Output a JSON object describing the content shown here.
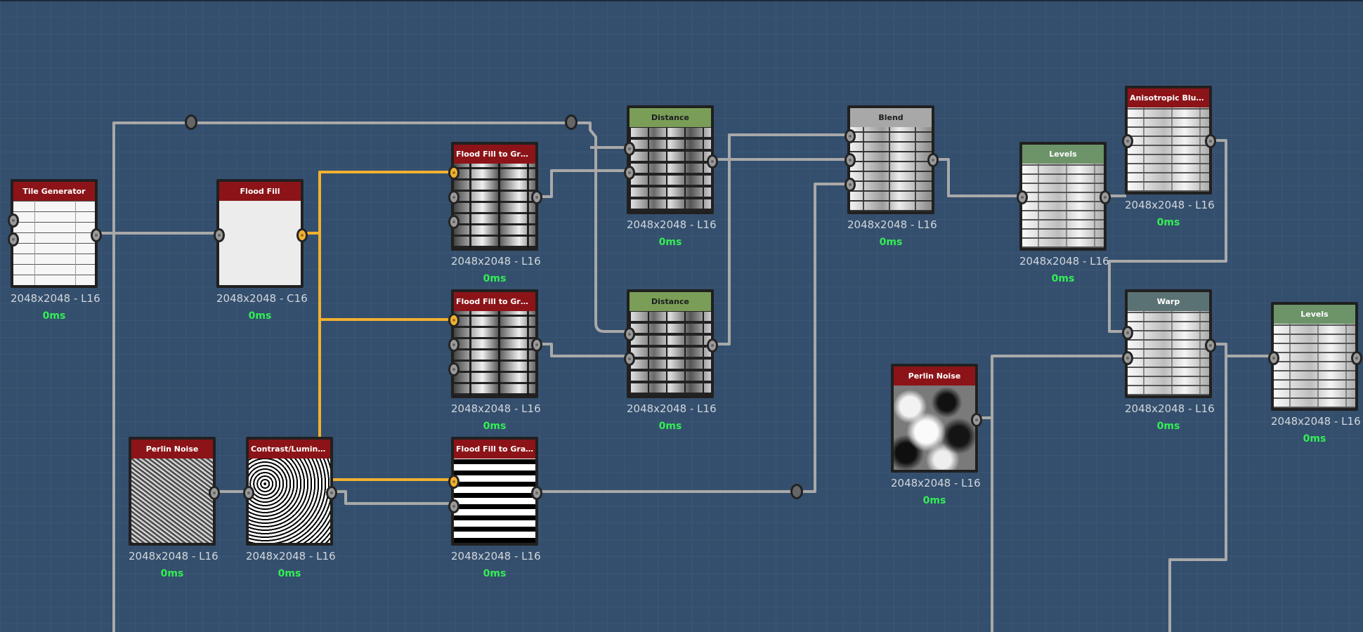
{
  "colors": {
    "canvas": "#344f6d",
    "wire": "#a9a9a9",
    "wire_active": "#f0b030",
    "header_red": "#8c1418",
    "header_green": "#7a9e58",
    "header_levels": "#6c9468",
    "header_gray": "#a8a8a8",
    "header_warp": "#5b7274",
    "time_text": "#33ee55"
  },
  "nodes": {
    "tile_generator": {
      "title": "Tile Generator",
      "size": "2048x2048 - L16",
      "time": "0ms",
      "thumb": "tiles"
    },
    "flood_fill": {
      "title": "Flood Fill",
      "size": "2048x2048 - C16",
      "time": "0ms",
      "thumb": "flat-white"
    },
    "flood_fill_gradient_1": {
      "title": "Flood Fill to Gradient",
      "size": "2048x2048 - L16",
      "time": "0ms",
      "thumb": "gradient-bricks"
    },
    "flood_fill_gradient_2": {
      "title": "Flood Fill to Gradient",
      "size": "2048x2048 - L16",
      "time": "0ms",
      "thumb": "gradient-bricks"
    },
    "flood_fill_grayscale": {
      "title": "Flood Fill to Grayscale",
      "size": "2048x2048 - L16",
      "time": "0ms",
      "thumb": "grayscale-bricks"
    },
    "perlin_noise_small": {
      "title": "Perlin Noise",
      "size": "2048x2048 - L16",
      "time": "0ms",
      "thumb": "fine-noise"
    },
    "contrast_luminosity": {
      "title": "Contrast/Luminosity G...",
      "size": "2048x2048 - L16",
      "time": "0ms",
      "thumb": "contrast-noise"
    },
    "distance_1": {
      "title": "Distance",
      "size": "2048x2048 - L16",
      "time": "0ms",
      "thumb": "distance-bricks"
    },
    "distance_2": {
      "title": "Distance",
      "size": "2048x2048 - L16",
      "time": "0ms",
      "thumb": "distance-bricks"
    },
    "blend": {
      "title": "Blend",
      "size": "2048x2048 - L16",
      "time": "0ms",
      "thumb": "blend-bricks"
    },
    "perlin_noise_large": {
      "title": "Perlin Noise",
      "size": "2048x2048 - L16",
      "time": "0ms",
      "thumb": "perlin-clouds"
    },
    "levels_1": {
      "title": "Levels",
      "size": "2048x2048 - L16",
      "time": "0ms",
      "thumb": "light-bricks"
    },
    "anisotropic_blur": {
      "title": "Anisotropic Blur Grays...",
      "size": "2048x2048 - L16",
      "time": "0ms",
      "thumb": "light-bricks"
    },
    "warp": {
      "title": "Warp",
      "size": "2048x2048 - L16",
      "time": "0ms",
      "thumb": "light-bricks"
    },
    "levels_2": {
      "title": "Levels",
      "size": "2048x2048 - L16",
      "time": "0ms",
      "thumb": "light-bricks"
    }
  }
}
